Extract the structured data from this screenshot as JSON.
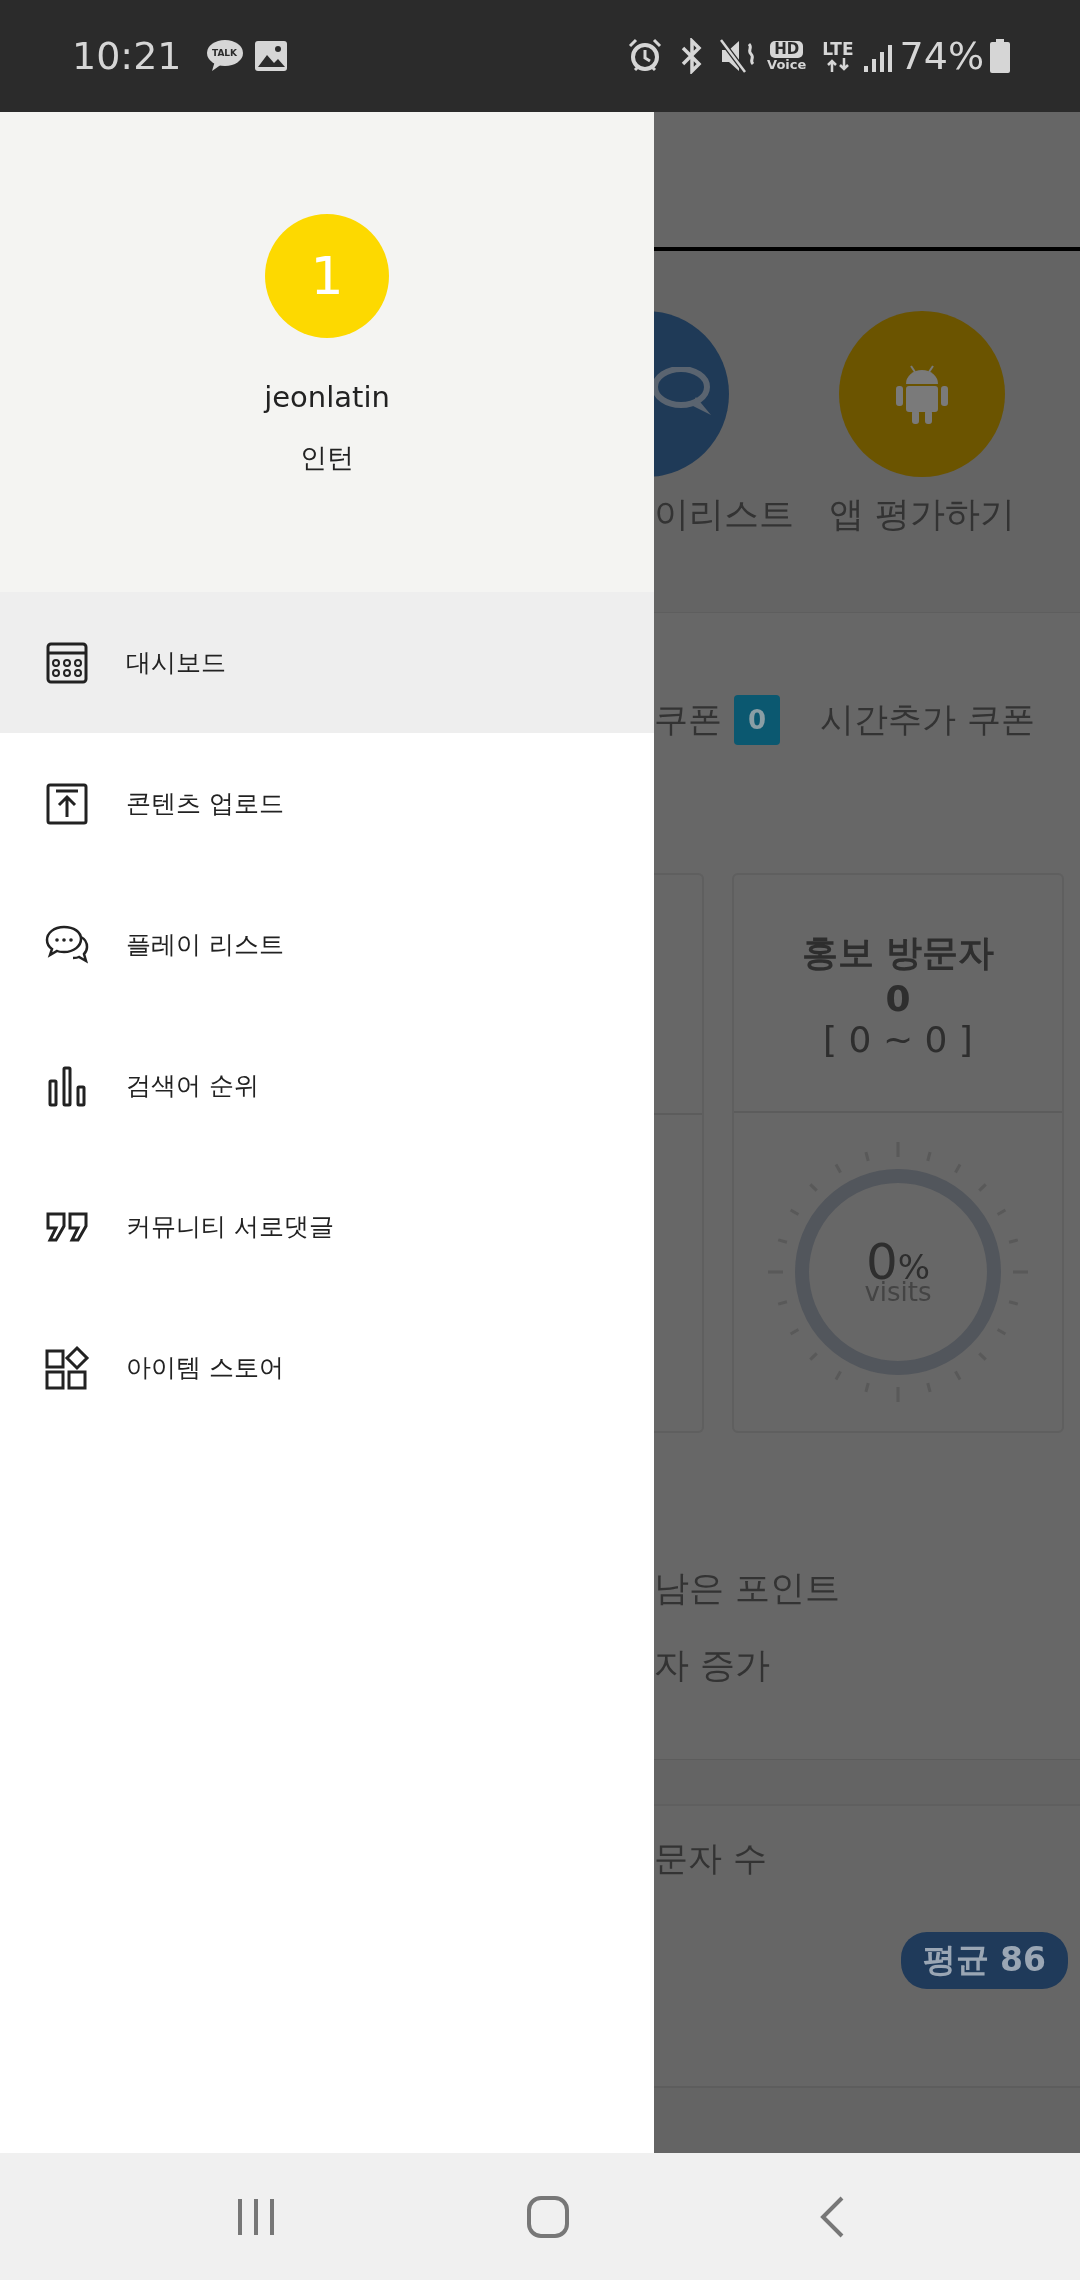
{
  "status_bar": {
    "time": "10:21",
    "talk_label": "TALK",
    "hd": "HD",
    "voice": "Voice",
    "network": "LTE",
    "battery": "74%"
  },
  "drawer": {
    "avatar": "1",
    "username": "jeonlatin",
    "role": "인턴",
    "items": [
      {
        "label": "대시보드",
        "kind": "calculator",
        "selected": true
      },
      {
        "label": "콘텐츠 업로드",
        "kind": "upload",
        "selected": false
      },
      {
        "label": "플레이 리스트",
        "kind": "chat",
        "selected": false
      },
      {
        "label": "검색어 순위",
        "kind": "bars",
        "selected": false
      },
      {
        "label": "커뮤니티 서로댓글",
        "kind": "quote",
        "selected": false
      },
      {
        "label": "아이템 스토어",
        "kind": "shapes",
        "selected": false
      }
    ]
  },
  "background": {
    "shortcuts": [
      {
        "label": "이리스트",
        "kind": "chat",
        "color": "#1f3a57"
      },
      {
        "label": "앱 평가하기",
        "kind": "android",
        "color": "#6b5400"
      }
    ],
    "coupons": {
      "label": "쿠폰",
      "count": "0",
      "other": "시간추가 쿠폰"
    },
    "stat": {
      "title": "홍보 방문자",
      "value": "0",
      "range": "[ 0 ~ 0 ]",
      "percent": "0",
      "percent_sign": "%",
      "unit": "visits"
    },
    "lines": [
      "남은 포인트",
      "자 증가"
    ],
    "visitors": {
      "label": "문자 수",
      "badge": "평균 86"
    }
  }
}
